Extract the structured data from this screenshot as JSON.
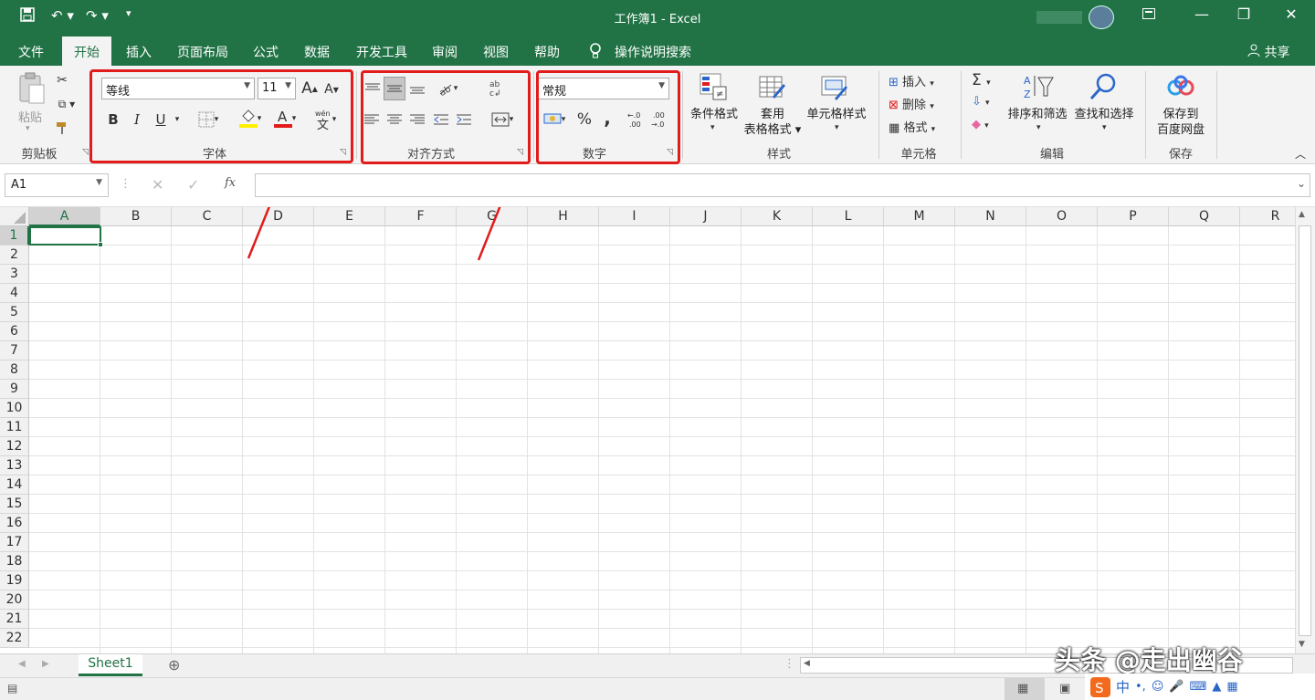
{
  "title_bar": {
    "title": "工作簿1  -  Excel"
  },
  "menu": {
    "tabs": [
      "文件",
      "开始",
      "插入",
      "页面布局",
      "公式",
      "数据",
      "开发工具",
      "审阅",
      "视图",
      "帮助"
    ],
    "active_tab": "开始",
    "tell_me": "操作说明搜索",
    "share": "共享"
  },
  "ribbon": {
    "clipboard": {
      "paste": "粘贴",
      "label": "剪贴板"
    },
    "font": {
      "name": "等线",
      "size": "11",
      "label": "字体",
      "bold": "B",
      "italic": "I",
      "underline": "U",
      "wen": "wén\n文"
    },
    "alignment": {
      "label": "对齐方式"
    },
    "number": {
      "format": "常规",
      "percent": "%",
      "comma": ",",
      "label": "数字"
    },
    "styles": {
      "conditional": "条件格式",
      "table_line1": "套用",
      "table_line2": "表格格式",
      "cell_styles": "单元格样式",
      "label": "样式"
    },
    "cells": {
      "insert": "插入",
      "delete": "删除",
      "format": "格式",
      "label": "单元格"
    },
    "editing": {
      "sort": "排序和筛选",
      "find": "查找和选择",
      "label": "编辑"
    },
    "save": {
      "line1": "保存到",
      "line2": "百度网盘",
      "label": "保存"
    }
  },
  "formula_bar": {
    "name_box": "A1",
    "fx": "fx"
  },
  "columns": [
    "A",
    "B",
    "C",
    "D",
    "E",
    "F",
    "G",
    "H",
    "I",
    "J",
    "K",
    "L",
    "M",
    "N",
    "O",
    "P",
    "Q",
    "R"
  ],
  "rows": [
    "1",
    "2",
    "3",
    "4",
    "5",
    "6",
    "7",
    "8",
    "9",
    "10",
    "11",
    "12",
    "13",
    "14",
    "15",
    "16",
    "17",
    "18",
    "19",
    "20",
    "21",
    "22"
  ],
  "sheet_tabs": [
    "Sheet1"
  ],
  "watermark": "头条 @走出幽谷",
  "colors": {
    "excel_green": "#217346",
    "highlight_red": "#e21b1b"
  }
}
